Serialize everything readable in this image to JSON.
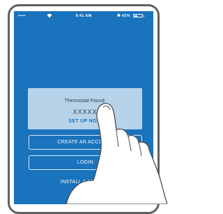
{
  "status_bar": {
    "signal": "•••••",
    "time": "9:41 AM",
    "bluetooth": "✱",
    "battery_text": "42%",
    "battery_level": 0.42
  },
  "found_card": {
    "title": "Thermostat Found:",
    "name": "XXXXX",
    "setup_label": "SET UP NOW"
  },
  "buttons": {
    "create_account": "CREATE AN ACCOUNT",
    "login": "LOGIN",
    "install_device": "INSTALL A DEVICE"
  },
  "icons": {
    "wifi": "wifi-icon",
    "bluetooth": "bluetooth-icon",
    "battery": "battery-icon",
    "hand": "pointing-hand-illustration"
  },
  "colors": {
    "screen_bg": "#1a73bd",
    "card_bg": "#b7d3ea",
    "device_frame": "#5f6062"
  }
}
